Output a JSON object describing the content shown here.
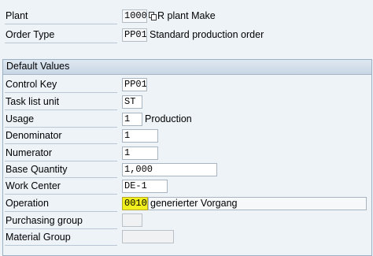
{
  "header": {
    "plant": {
      "label": "Plant",
      "value": "1000",
      "description": "R plant Make"
    },
    "order_type": {
      "label": "Order Type",
      "value": "PP01",
      "description": "Standard production order"
    }
  },
  "default_values": {
    "title": "Default Values",
    "control_key": {
      "label": "Control Key",
      "value": "PP01"
    },
    "task_list_unit": {
      "label": "Task list unit",
      "value": "ST"
    },
    "usage": {
      "label": "Usage",
      "value": "1",
      "description": "Production"
    },
    "denominator": {
      "label": "Denominator",
      "value": "1"
    },
    "numerator": {
      "label": "Numerator",
      "value": "1"
    },
    "base_quantity": {
      "label": "Base Quantity",
      "value": "1,000"
    },
    "work_center": {
      "label": "Work Center",
      "value": "DE-1"
    },
    "operation": {
      "label": "Operation",
      "value": "0010",
      "description": "generierter Vorgang"
    },
    "purchasing_group": {
      "label": "Purchasing group",
      "value": ""
    },
    "material_group": {
      "label": "Material Group",
      "value": ""
    }
  },
  "colors": {
    "background": "#eef3f8",
    "highlight": "#f2ef1e",
    "group_header": "#c9d7e5"
  },
  "icons": {
    "plant_copy": "copy-icon"
  }
}
